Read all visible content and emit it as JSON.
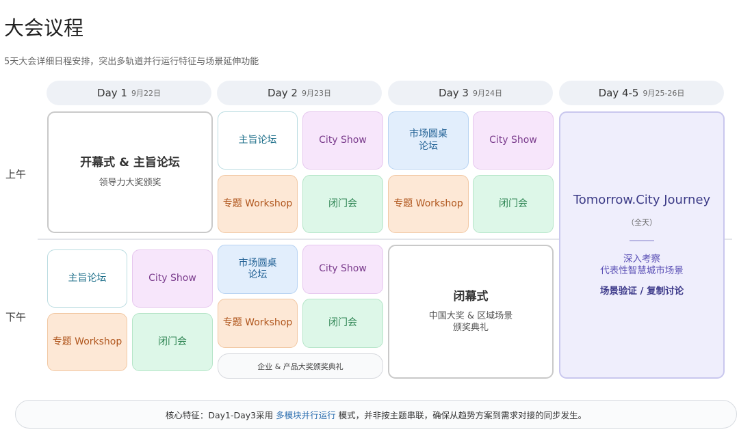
{
  "title": "大会议程",
  "subtitle": "5天大会详细日程安排，突出多轨道并行运行特征与场景延伸功能",
  "days": [
    {
      "label": "Day 1",
      "date": "9月22日"
    },
    {
      "label": "Day 2",
      "date": "9月23日"
    },
    {
      "label": "Day 3",
      "date": "9月24日"
    },
    {
      "label": "Day 4-5",
      "date": "9月25-26日"
    }
  ],
  "periods": {
    "am": "上午",
    "pm": "下午"
  },
  "day1": {
    "am": {
      "title": "开幕式 & 主旨论坛",
      "sub": "领导力大奖颁奖"
    },
    "pm": [
      "主旨论坛",
      "City Show",
      "专题 Workshop",
      "闭门会"
    ]
  },
  "day2": {
    "am": [
      "主旨论坛",
      "City Show",
      "专题 Workshop",
      "闭门会"
    ],
    "pm": [
      "市场圆桌\n论坛",
      "City Show",
      "专题 Workshop",
      "闭门会"
    ],
    "award": "企业 & 产品大奖颁奖典礼"
  },
  "day3": {
    "am": [
      "市场圆桌\n论坛",
      "City Show",
      "专题 Workshop",
      "闭门会"
    ],
    "pm": {
      "title": "闭幕式",
      "sub": "中国大奖 & 区域场景\n颁奖典礼"
    }
  },
  "day45": {
    "title": "Tomorrow.City Journey",
    "full": "（全天）",
    "line1": "深入考察\n代表性智慧城市场景",
    "line2": "场景验证 / 复制讨论"
  },
  "footer": {
    "prefix": "核心特征：Day1-Day3采用",
    "highlight": "多模块并行运行",
    "suffix": "模式，并非按主题串联，确保从趋势方案到需求对接的同步发生。"
  },
  "colors": {
    "white_card_border": "#b9dbe0",
    "pink": "#f7e6fb",
    "orange": "#fde8d6",
    "green": "#ddf7e8",
    "blue": "#e2eefc",
    "purple": "#efeefc"
  }
}
